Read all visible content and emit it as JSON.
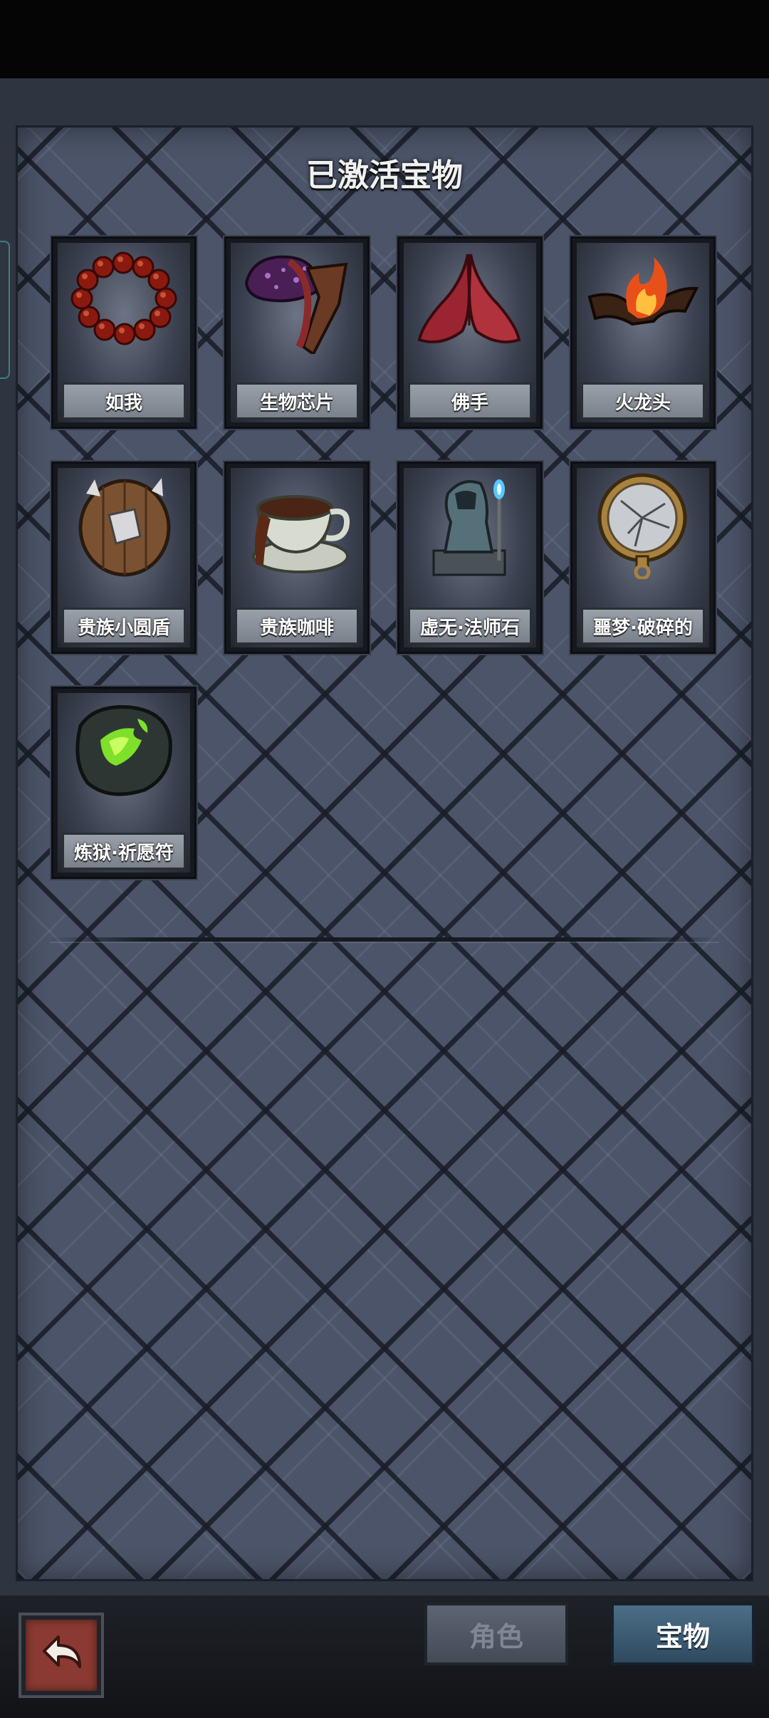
{
  "panel": {
    "title": "已激活宝物"
  },
  "treasures": [
    {
      "name": "如我",
      "icon": "prayer-beads-icon"
    },
    {
      "name": "生物芯片",
      "icon": "biochip-icon"
    },
    {
      "name": "佛手",
      "icon": "praying-hands-icon"
    },
    {
      "name": "火龙头",
      "icon": "fire-dragon-head-icon"
    },
    {
      "name": "贵族小圆盾",
      "icon": "round-shield-icon"
    },
    {
      "name": "贵族咖啡",
      "icon": "coffee-cup-icon"
    },
    {
      "name": "虚无·法师石",
      "icon": "mage-statue-icon"
    },
    {
      "name": "噩梦·破碎的",
      "icon": "broken-pocket-watch-icon"
    },
    {
      "name": "炼狱·祈愿符",
      "icon": "green-rune-stone-icon"
    }
  ],
  "bottom_nav": {
    "back_icon": "back-arrow-icon",
    "tab_role": "角色",
    "tab_treasure": "宝物",
    "active_tab": "宝物"
  },
  "colors": {
    "panel_bg": "#4b5468",
    "active_tab": "#3e6078",
    "back_button": "#8a3a32"
  }
}
